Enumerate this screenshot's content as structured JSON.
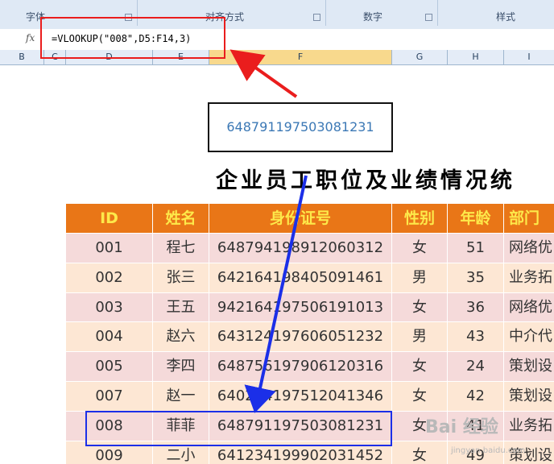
{
  "ribbon": {
    "groups": [
      {
        "label": "字体"
      },
      {
        "label": "对齐方式"
      },
      {
        "label": "数字"
      },
      {
        "label": "样式"
      }
    ]
  },
  "formula_bar": {
    "fx_label": "fx",
    "formula": "=VLOOKUP(\"008\",D5:F14,3)"
  },
  "columns": [
    "B",
    "C",
    "D",
    "E",
    "F",
    "G",
    "H",
    "I"
  ],
  "selected_column": "F",
  "result_value": "648791197503081231",
  "sheet_title": "企业员工职位及业绩情况统",
  "table": {
    "headers": [
      "ID",
      "姓名",
      "身份证号",
      "性别",
      "年龄",
      "部门"
    ],
    "rows": [
      [
        "001",
        "程七",
        "648794198912060312",
        "女",
        "51",
        "网络优"
      ],
      [
        "002",
        "张三",
        "642164198405091461",
        "男",
        "35",
        "业务拓"
      ],
      [
        "003",
        "王五",
        "942164197506191013",
        "女",
        "36",
        "网络优"
      ],
      [
        "004",
        "赵六",
        "643124197606051232",
        "男",
        "43",
        "中介代"
      ],
      [
        "005",
        "李四",
        "648756197906120316",
        "女",
        "24",
        "策划设"
      ],
      [
        "007",
        "赵一",
        "640254197512041346",
        "女",
        "42",
        "策划设"
      ],
      [
        "008",
        "菲菲",
        "648791197503081231",
        "女",
        "41",
        "业务拓"
      ],
      [
        "009",
        "二小",
        "641234199902031452",
        "女",
        "49",
        "策划设"
      ]
    ],
    "row_colors": [
      "#f5dada",
      "#fde7d4"
    ]
  },
  "colors": {
    "header_bg": "#e97617",
    "header_text": "#fde94a",
    "highlight_red": "#ea1d1d",
    "highlight_blue": "#1b2fe8"
  },
  "watermark": {
    "main": "Bai 经验",
    "sub": "jingyan.baidu.com"
  }
}
